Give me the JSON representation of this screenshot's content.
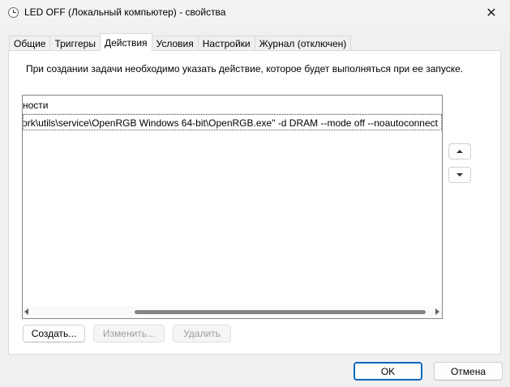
{
  "window": {
    "title": "LED OFF (Локальный компьютер) - свойства",
    "icon": "clock-icon",
    "close_glyph": "✕"
  },
  "tabs": [
    {
      "label": "Общие",
      "active": false
    },
    {
      "label": "Триггеры",
      "active": false
    },
    {
      "label": "Действия",
      "active": true
    },
    {
      "label": "Условия",
      "active": false
    },
    {
      "label": "Настройки",
      "active": false
    },
    {
      "label": "Журнал (отключен)",
      "active": false
    }
  ],
  "actions_tab": {
    "description": "При создании задачи необходимо указать действие, которое будет выполняться при ее запуске.",
    "list": {
      "header_visible_text": "ности",
      "rows": [
        {
          "visible_text": "ork\\utils\\service\\OpenRGB Windows 64-bit\\OpenRGB.exe\" -d DRAM --mode off --noautoconnect"
        }
      ]
    },
    "buttons": {
      "create": "Создать...",
      "edit": "Изменить...",
      "delete": "Удалить"
    }
  },
  "footer": {
    "ok": "OK",
    "cancel": "Отмена"
  },
  "colors": {
    "accent": "#0067c0",
    "background": "#f0f0f0",
    "disabled_text": "#9d9d9d"
  }
}
